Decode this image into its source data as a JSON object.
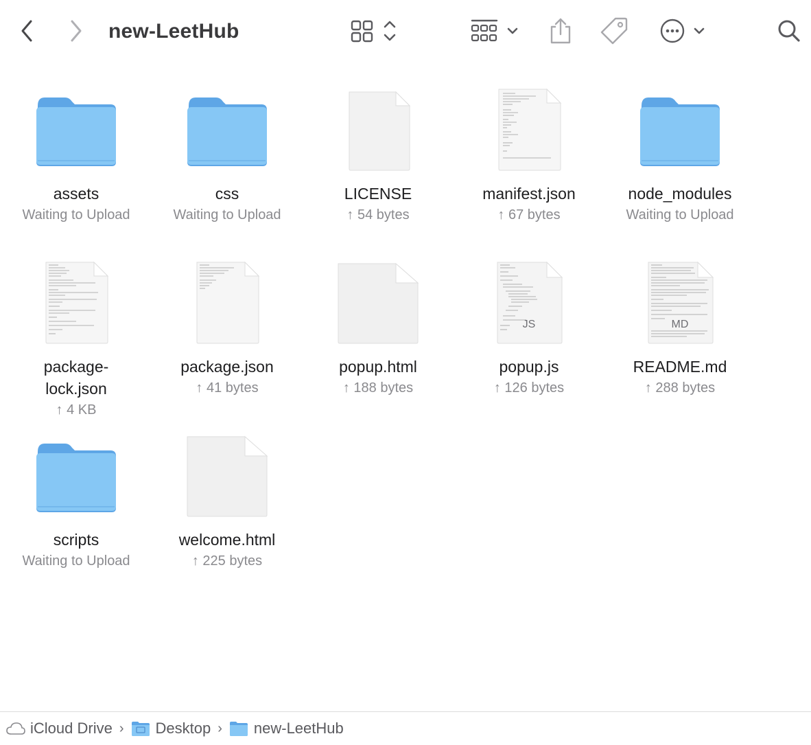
{
  "toolbar": {
    "title": "new-LeetHub",
    "icons": [
      "back-icon",
      "forward-icon",
      "icon-view-icon",
      "group-icon",
      "share-icon",
      "tag-icon",
      "more-icon",
      "search-icon"
    ]
  },
  "colors": {
    "folder_body": "#86c7f5",
    "folder_tab": "#5ea6e6",
    "document": "#f2f2f2",
    "status_text": "#8a8a8e"
  },
  "items": [
    {
      "name": "assets",
      "status": "Waiting to Upload",
      "kind": "folder"
    },
    {
      "name": "css",
      "status": "Waiting to Upload",
      "kind": "folder"
    },
    {
      "name": "LICENSE",
      "status": "↑ 54 bytes",
      "kind": "document"
    },
    {
      "name": "manifest.json",
      "status": "↑ 67 bytes",
      "kind": "text-document"
    },
    {
      "name": "node_modules",
      "status": "Waiting to Upload",
      "kind": "folder"
    },
    {
      "name_line1": "package-",
      "name_line2": "lock.json",
      "status": "↑ 4 KB",
      "kind": "text-document"
    },
    {
      "name": "package.json",
      "status": "↑ 41 bytes",
      "kind": "text-document"
    },
    {
      "name": "popup.html",
      "status": "↑ 188 bytes",
      "kind": "document"
    },
    {
      "name": "popup.js",
      "status": "↑ 126 bytes",
      "kind": "js-document",
      "badge": "JS"
    },
    {
      "name": "README.md",
      "status": "↑ 288 bytes",
      "kind": "md-document",
      "badge": "MD"
    },
    {
      "name": "scripts",
      "status": "Waiting to Upload",
      "kind": "folder"
    },
    {
      "name": "welcome.html",
      "status": "↑ 225 bytes",
      "kind": "document"
    }
  ],
  "pathbar": {
    "crumbs": [
      "iCloud Drive",
      "Desktop",
      "new-LeetHub"
    ],
    "separator": "›"
  }
}
